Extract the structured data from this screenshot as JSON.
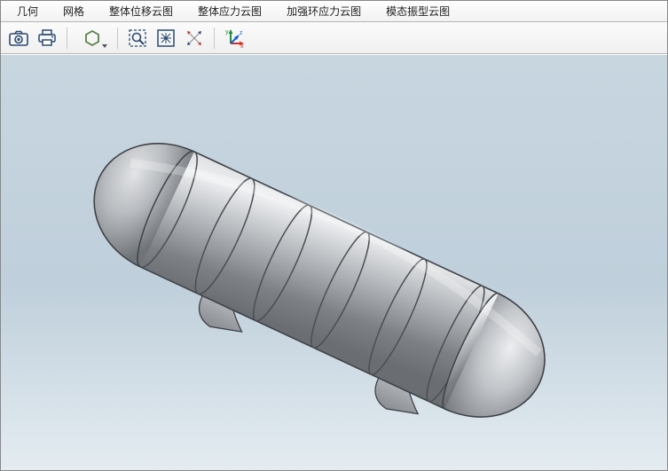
{
  "menu": {
    "items": [
      {
        "label": "几何"
      },
      {
        "label": "网格"
      },
      {
        "label": "整体位移云图"
      },
      {
        "label": "整体应力云图"
      },
      {
        "label": "加强环应力云图"
      },
      {
        "label": "模态振型云图"
      }
    ]
  },
  "toolbar": {
    "camera": "camera",
    "print": "print",
    "shade": "shade-mode",
    "zoom_window": "zoom-window",
    "fit": "zoom-fit",
    "pan": "pan",
    "triad": "axis-triad"
  },
  "viewport": {
    "model": "pressure-vessel",
    "axes": {
      "x": "x",
      "y": "y",
      "z": "z"
    }
  }
}
